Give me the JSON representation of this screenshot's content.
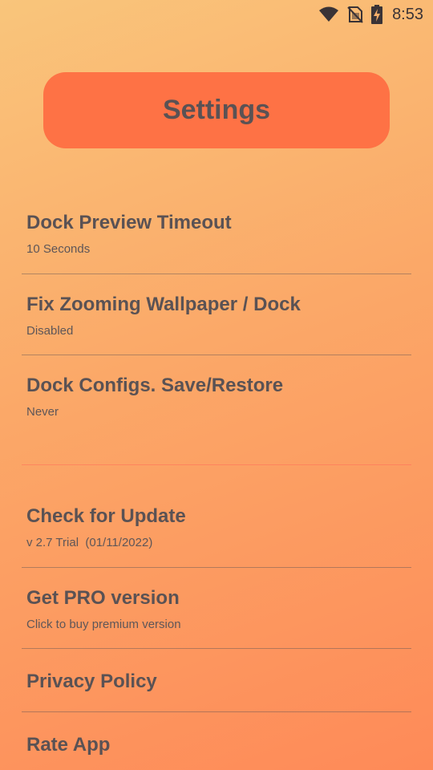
{
  "status_bar": {
    "time": "8:53",
    "icons": [
      "wifi-icon",
      "no-sim-icon",
      "battery-charging-icon"
    ]
  },
  "header": {
    "title": "Settings"
  },
  "settings": {
    "items": [
      {
        "title": "Dock Preview Timeout",
        "subtitle": "10 Seconds"
      },
      {
        "title": "Fix Zooming Wallpaper / Dock",
        "subtitle": "Disabled"
      },
      {
        "title": "Dock Configs. Save/Restore",
        "subtitle": "Never"
      },
      {
        "title": "Check for Update",
        "subtitle": "v 2.7 Trial  (01/11/2022)"
      },
      {
        "title": "Get PRO version",
        "subtitle": "Click to buy premium version"
      },
      {
        "title": "Privacy Policy"
      },
      {
        "title": "Rate App"
      }
    ]
  },
  "colors": {
    "accent": "#fe7245",
    "text": "#5a5254",
    "gradient_start": "#f9c57b",
    "gradient_end": "#fe8a58"
  }
}
